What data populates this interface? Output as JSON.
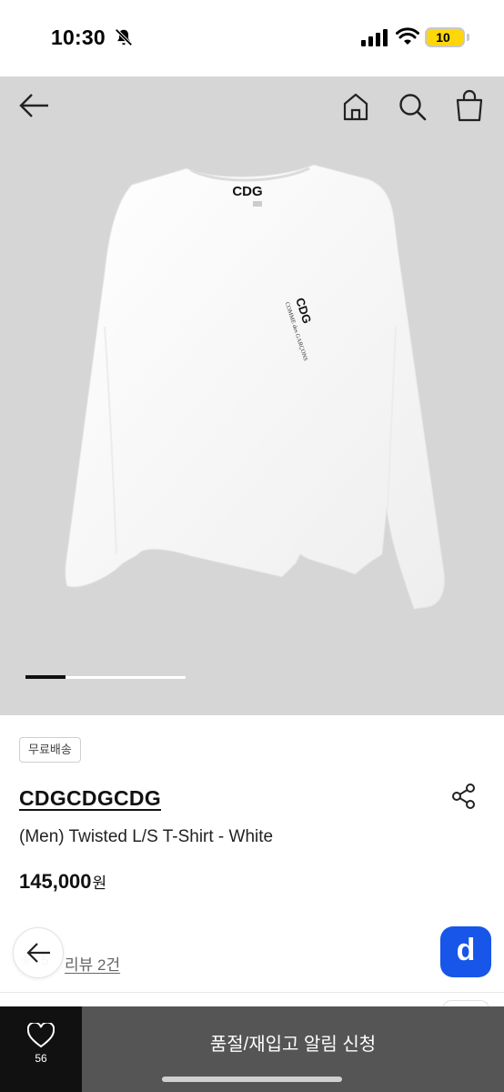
{
  "status_bar": {
    "time": "10:30",
    "battery": "10",
    "icons": [
      "bell-off-icon",
      "signal-icon",
      "wifi-icon",
      "battery-icon"
    ]
  },
  "nav": {
    "icons": [
      "back-arrow-icon",
      "home-icon",
      "search-icon",
      "shopping-bag-icon"
    ]
  },
  "product_image": {
    "logo_text": "CDG",
    "chest_logo_text": "CDG",
    "chest_sub_text": "COMME des GARÇONS",
    "carousel_position": 0.25
  },
  "product": {
    "badge": "무료배송",
    "brand": "CDGCDGCDG",
    "name": "(Men) Twisted L/S T-Shirt - White",
    "price": "145,000",
    "price_unit": "원",
    "review_score": "5",
    "review_link": "리뷰 2건"
  },
  "floating": {
    "app_icon_letter": "d"
  },
  "bottom_bar": {
    "like_count": "56",
    "restock_label": "품절/재입고 알림 신청"
  },
  "colors": {
    "hero_bg": "#d6d6d6",
    "app_icon": "#1756e8",
    "bottom_bar": "#555555",
    "like_box": "#111111",
    "battery": "#ffd60a"
  }
}
